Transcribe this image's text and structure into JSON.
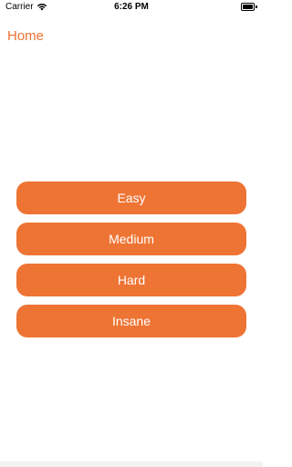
{
  "status_bar": {
    "carrier": "Carrier",
    "time": "6:26 PM",
    "wifi_icon": "wifi-icon",
    "battery_icon": "battery-icon"
  },
  "nav": {
    "back_label": "Home"
  },
  "levels": [
    {
      "label": "Easy"
    },
    {
      "label": "Medium"
    },
    {
      "label": "Hard"
    },
    {
      "label": "Insane"
    }
  ],
  "colors": {
    "accent": "#ee7434",
    "nav_text": "#ee7030",
    "button_text": "#ffffff",
    "background": "#ffffff"
  }
}
